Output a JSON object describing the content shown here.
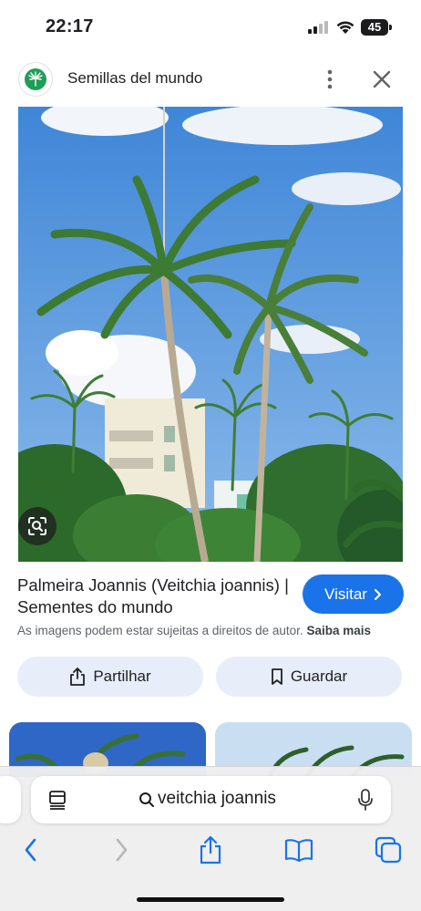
{
  "status_bar": {
    "time": "22:17",
    "battery": "45"
  },
  "site": {
    "name": "Semillas del mundo",
    "logo_icon": "palm-leaf-icon",
    "brand_color": "#1e9e56"
  },
  "image": {
    "alt_subject": "palm-trees-photo"
  },
  "result": {
    "title": "Palmeira Joannis (Veitchia joannis) | Sementes do mundo",
    "visit_label": "Visitar",
    "copyright_text": "As imagens podem estar sujeitas a direitos de autor.",
    "learn_more": "Saiba mais"
  },
  "actions": {
    "share_label": "Partilhar",
    "save_label": "Guardar"
  },
  "browser": {
    "address": "veitchia joannis"
  },
  "colors": {
    "accent": "#1a73e8",
    "chip_bg": "#e8eef9",
    "toolbar_icon": "#1a73e8"
  }
}
